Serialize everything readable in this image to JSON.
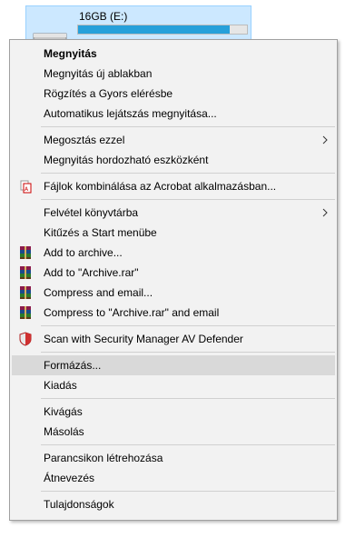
{
  "drive": {
    "label": "16GB (E:)",
    "usage_fraction": 0.9,
    "icon": "removable-drive-icon"
  },
  "menu": {
    "items": [
      {
        "label": "Megnyitás",
        "bold": true
      },
      {
        "label": "Megnyitás új ablakban"
      },
      {
        "label": "Rögzítés a Gyors elérésbe"
      },
      {
        "label": "Automatikus lejátszás megnyitása..."
      },
      {
        "label": "Megosztás ezzel",
        "submenu": true
      },
      {
        "label": "Megnyitás hordozható eszközként"
      },
      {
        "label": "Fájlok kombinálása az Acrobat alkalmazásban...",
        "icon": "acrobat-icon"
      },
      {
        "label": "Felvétel könyvtárba",
        "submenu": true
      },
      {
        "label": "Kitűzés a Start menübe"
      },
      {
        "label": "Add to archive...",
        "icon": "winrar-icon"
      },
      {
        "label": "Add to \"Archive.rar\"",
        "icon": "winrar-icon"
      },
      {
        "label": "Compress and email...",
        "icon": "winrar-icon"
      },
      {
        "label": "Compress to \"Archive.rar\" and email",
        "icon": "winrar-icon"
      },
      {
        "label": "Scan with Security Manager AV Defender",
        "icon": "shield-icon"
      },
      {
        "label": "Formázás...",
        "highlighted": true
      },
      {
        "label": "Kiadás"
      },
      {
        "label": "Kivágás"
      },
      {
        "label": "Másolás"
      },
      {
        "label": "Parancsikon létrehozása"
      },
      {
        "label": "Átnevezés"
      },
      {
        "label": "Tulajdonságok"
      }
    ]
  },
  "colors": {
    "menu_background": "#f2f2f2",
    "highlight": "#d9d9d9",
    "drive_selection": "#cce8ff",
    "progress_fill": "#26a0da"
  }
}
